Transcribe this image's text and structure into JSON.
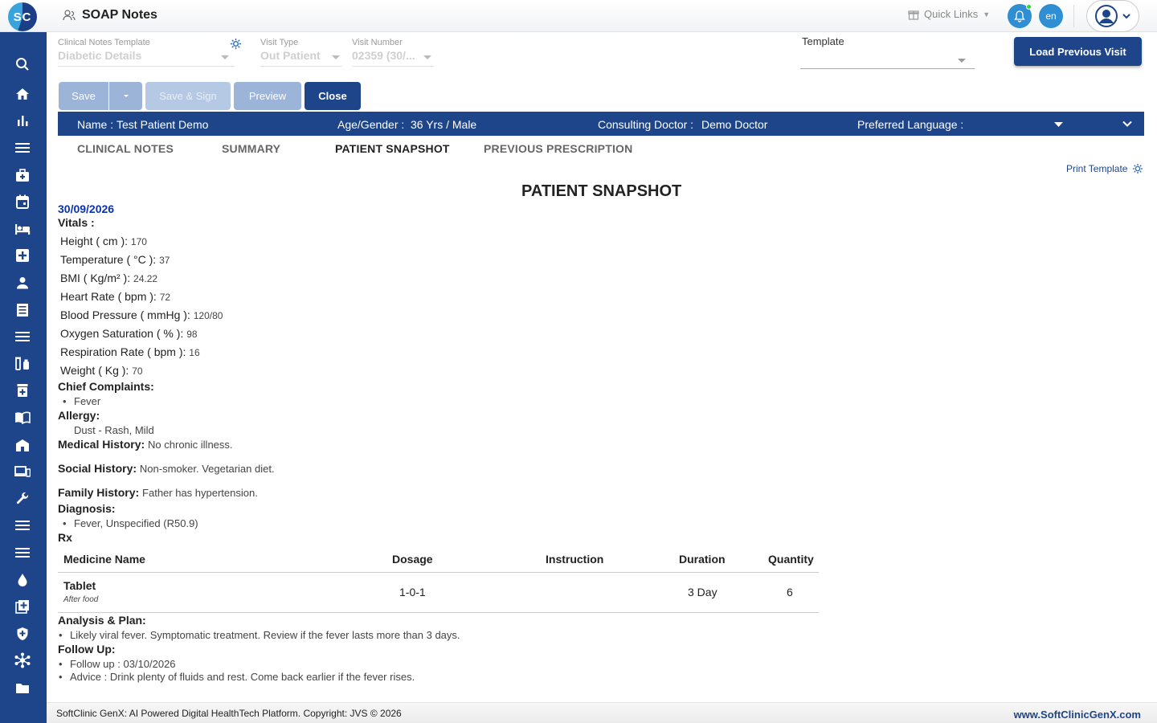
{
  "app": {
    "logo_text": "SC",
    "title": "SOAP Notes"
  },
  "header": {
    "quick_links": "Quick Links",
    "language": "en"
  },
  "sidebar": {
    "items": [
      "search-icon",
      "home-icon",
      "analytics-icon",
      "menu-icon",
      "medical-bag-icon",
      "calendar-icon",
      "bed-icon",
      "add-medical-icon",
      "person-icon",
      "receipt-icon",
      "menu-icon",
      "vaccine-icon",
      "medicine-box-icon",
      "book-icon",
      "hospital-building-icon",
      "devices-icon",
      "wrench-icon",
      "menu-icon",
      "menu-icon",
      "blood-drop-icon",
      "add-box-icon",
      "shield-icon",
      "hub-icon",
      "folder-icon"
    ]
  },
  "form": {
    "clinical_notes_template_label": "Clinical Notes Template",
    "clinical_notes_template_value": "Diabetic Details",
    "visit_type_label": "Visit Type",
    "visit_type_value": "Out Patient",
    "visit_number_label": "Visit Number",
    "visit_number_value": "02359 (30/...",
    "template_label": "Template",
    "template_value": ""
  },
  "buttons": {
    "load_previous_visit": "Load Previous Visit",
    "save": "Save",
    "save_sign": "Save & Sign",
    "preview": "Preview",
    "close": "Close"
  },
  "patient": {
    "name_label": "Name :",
    "name": "Test Patient Demo",
    "age_gender_label": "Age/Gender :",
    "age_gender": "36 Yrs / Male",
    "doctor_label": "Consulting Doctor :",
    "doctor": "Demo Doctor",
    "language_label": "Preferred Language :",
    "language": ""
  },
  "tabs": [
    "CLINICAL NOTES",
    "SUMMARY",
    "PATIENT SNAPSHOT",
    "PREVIOUS PRESCRIPTION"
  ],
  "print_template": "Print Template",
  "snapshot": {
    "title": "PATIENT SNAPSHOT",
    "date": "30/09/2026",
    "vitals_heading": "Vitals :",
    "vitals": [
      {
        "label": "Height ( cm ):",
        "value": "170"
      },
      {
        "label": "Temperature ( °C ):",
        "value": "37"
      },
      {
        "label": "BMI ( Kg/m² ):",
        "value": "24.22"
      },
      {
        "label": "Heart Rate ( bpm ):",
        "value": "72"
      },
      {
        "label": "Blood Pressure ( mmHg ):",
        "value": "120/80"
      },
      {
        "label": "Oxygen Saturation ( % ):",
        "value": "98"
      },
      {
        "label": "Respiration Rate ( bpm ):",
        "value": "16"
      },
      {
        "label": "Weight ( Kg ):",
        "value": "70"
      }
    ],
    "chief_complaints_heading": "Chief Complaints:",
    "chief_complaints": [
      "Fever"
    ],
    "allergy_heading": "Allergy:",
    "allergy": "Dust - Rash, Mild",
    "medical_history_heading": "Medical History:",
    "medical_history": "No chronic illness.",
    "social_history_heading": "Social History:",
    "social_history": "Non-smoker. Vegetarian diet.",
    "family_history_heading": "Family History:",
    "family_history": "Father has hypertension.",
    "diagnosis_heading": "Diagnosis:",
    "diagnosis": [
      "Fever, Unspecified (R50.9)"
    ],
    "rx_heading": "Rx",
    "rx_columns": [
      "Medicine Name",
      "Dosage",
      "Instruction",
      "Duration",
      "Quantity"
    ],
    "rx_rows": [
      {
        "medicine": "Tablet",
        "note": "After food",
        "dosage": "1-0-1",
        "instruction": "",
        "duration": "3 Day",
        "quantity": "6"
      }
    ],
    "analysis_heading": "Analysis & Plan:",
    "analysis": [
      "Likely viral fever. Symptomatic treatment. Review if the fever lasts more than 3 days."
    ],
    "followup_heading": "Follow Up:",
    "followup": [
      "Follow up : 03/10/2026",
      "Advice : Drink plenty of fluids and rest. Come back earlier if the fever rises."
    ]
  },
  "footer": {
    "text": "SoftClinic GenX: AI Powered Digital HealthTech Platform. Copyright: JVS © 2026",
    "link": "www.SoftClinicGenX.com"
  },
  "colors": {
    "primary": "#1e4589",
    "accent": "#2f8fd2",
    "date": "#0b32b3"
  }
}
